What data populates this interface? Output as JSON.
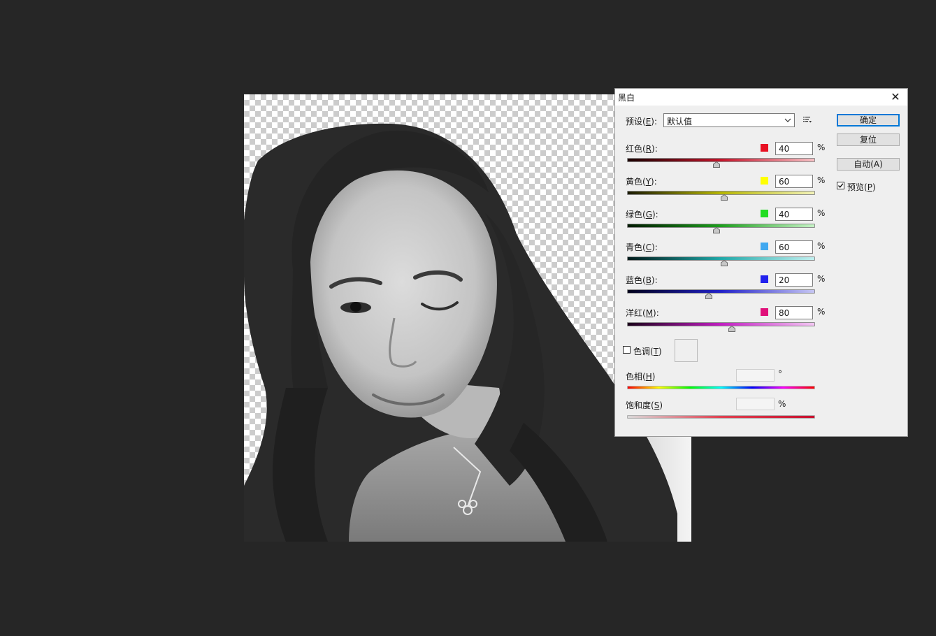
{
  "dialog": {
    "title": "黑白",
    "close_glyph": "✕",
    "preset": {
      "label_prefix": "预设(",
      "accel": "E",
      "label_suffix": "):",
      "value": "默认值"
    },
    "menu_icon": "preset-options-icon",
    "sliders": [
      {
        "label_prefix": "红色(",
        "accel": "R",
        "label_suffix": "):",
        "value": "40",
        "unit": "%",
        "swatch": "#e81123",
        "gradient": [
          "#1a0000",
          "#c4142a",
          "#f6c0c4"
        ],
        "position": 0.48
      },
      {
        "label_prefix": "黄色(",
        "accel": "Y",
        "label_suffix": "):",
        "value": "60",
        "unit": "%",
        "swatch": "#ffff00",
        "gradient": [
          "#1a1a00",
          "#b6b600",
          "#f3f3b8"
        ],
        "position": 0.52
      },
      {
        "label_prefix": "绿色(",
        "accel": "G",
        "label_suffix": "):",
        "value": "40",
        "unit": "%",
        "swatch": "#22dd22",
        "gradient": [
          "#001a00",
          "#1ea01e",
          "#c6f3c6"
        ],
        "position": 0.48
      },
      {
        "label_prefix": "青色(",
        "accel": "C",
        "label_suffix": "):",
        "value": "60",
        "unit": "%",
        "swatch": "#3fa8f0",
        "gradient": [
          "#001a1a",
          "#20a8a8",
          "#c2f0f0"
        ],
        "position": 0.52
      },
      {
        "label_prefix": "蓝色(",
        "accel": "B",
        "label_suffix": "):",
        "value": "20",
        "unit": "%",
        "swatch": "#2222ee",
        "gradient": [
          "#00001a",
          "#2222c8",
          "#c6c6f3"
        ],
        "position": 0.44
      },
      {
        "label_prefix": "洋红(",
        "accel": "M",
        "label_suffix": "):",
        "value": "80",
        "unit": "%",
        "swatch": "#e0107a",
        "gradient": [
          "#1a001a",
          "#c21ec2",
          "#f3c6f3"
        ],
        "position": 0.56
      }
    ],
    "tint": {
      "label_prefix": "色调(",
      "accel": "T",
      "label_suffix": ")",
      "checked": false
    },
    "hue": {
      "label_prefix": "色相(",
      "accel": "H",
      "label_suffix": ")",
      "value": "",
      "unit": "°"
    },
    "saturation": {
      "label_prefix": "饱和度(",
      "accel": "S",
      "label_suffix": ")",
      "value": "",
      "unit": "%"
    },
    "buttons": {
      "ok": "确定",
      "reset": "复位",
      "auto": "自动(A)"
    },
    "preview": {
      "label_prefix": "预览(",
      "accel": "P",
      "label_suffix": ")",
      "checked": true
    }
  },
  "canvas": {
    "description_icon": "grayscale-portrait-image"
  },
  "colors": {
    "app_background": "#262626",
    "dialog_background": "#efefef",
    "accent": "#0078d7"
  }
}
